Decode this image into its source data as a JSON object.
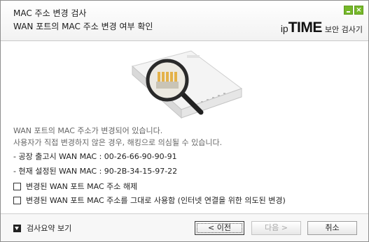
{
  "window": {
    "title": "MAC 주소 변경 검사",
    "subtitle": "WAN 포트의 MAC 주소 변경 여부 확인",
    "minimize_icon": "minimize-icon",
    "close_icon": "close-icon",
    "close_glyph": "×",
    "accent_color": "#76b82a"
  },
  "brand": {
    "prefix": "ip",
    "name": "TIME",
    "product": "보안 검사기"
  },
  "illustration": {
    "icon": "router-magnifier-icon"
  },
  "message": {
    "line1": "WAN 포트의 MAC 주소가 변경되어 있습니다.",
    "line2": "사용자가 직접 변경하지 않은 경우, 해킹으로 의심될 수 있습니다."
  },
  "mac_info": {
    "factory": "- 공장 출고시 WAN MAC : 00-26-66-90-90-91",
    "current": "- 현재 설정된 WAN MAC : 90-2B-34-15-97-22"
  },
  "options": [
    {
      "label": "변경된 WAN 포트 MAC 주소 해제",
      "checked": false
    },
    {
      "label": "변경된 WAN 포트 MAC 주소를 그대로 사용함 (인터넷 연결을 위한 의도된 변경)",
      "checked": false
    }
  ],
  "footer": {
    "summary_label": "검사요약 보기",
    "prev_label": "< 이전",
    "next_label": "다음 >",
    "cancel_label": "취소"
  }
}
